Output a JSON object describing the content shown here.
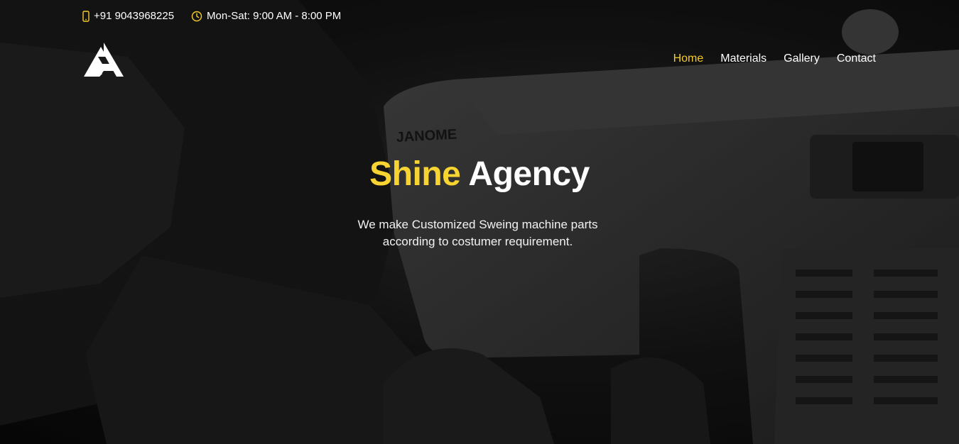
{
  "colors": {
    "accent": "#f5cc2e",
    "text": "#ffffff",
    "overlay": "#000000"
  },
  "topbar": {
    "phone_icon": "phone-icon",
    "phone": "+91 9043968225",
    "clock_icon": "clock-icon",
    "hours": "Mon-Sat: 9:00 AM - 8:00 PM"
  },
  "logo": {
    "icon": "brand-logo"
  },
  "nav": {
    "items": [
      {
        "label": "Home",
        "active": true
      },
      {
        "label": "Materials",
        "active": false
      },
      {
        "label": "Gallery",
        "active": false
      },
      {
        "label": "Contact",
        "active": false
      }
    ]
  },
  "hero": {
    "title_accent": "Shine",
    "title_rest": "Agency",
    "subtitle": "We make Customized Sweing machine parts according to costumer requirement.",
    "background_image": "sewing-machine-photo",
    "machine_brand": "JANOME"
  }
}
